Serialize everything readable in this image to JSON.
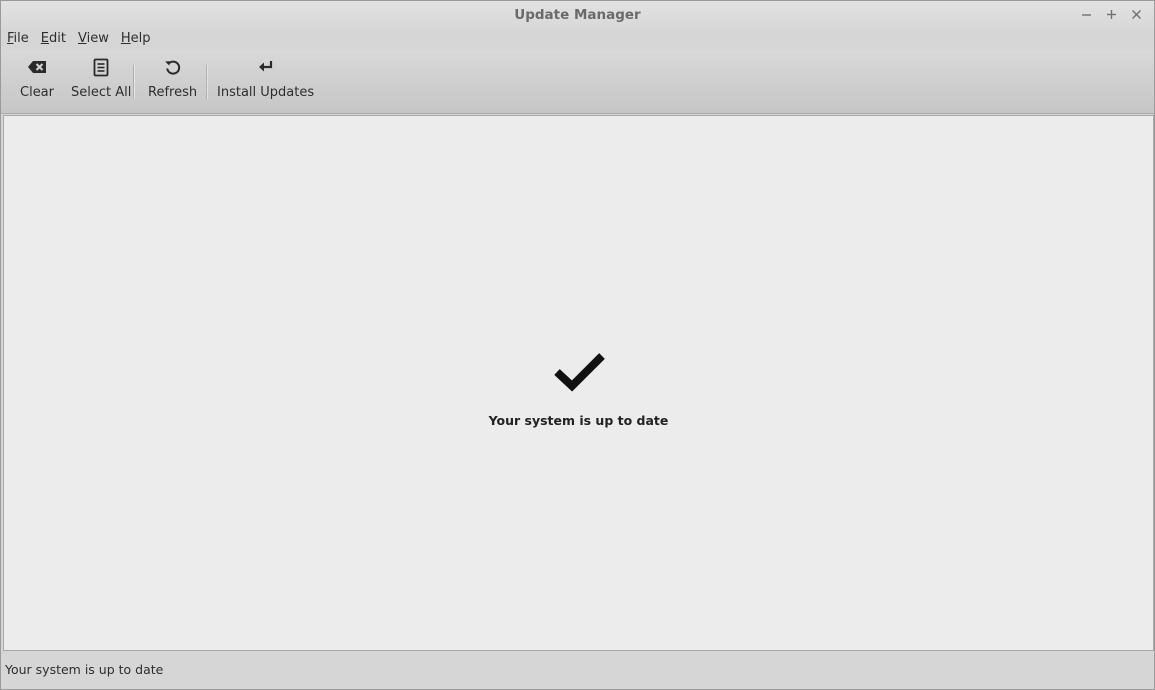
{
  "window": {
    "title": "Update Manager"
  },
  "menubar": {
    "items": [
      {
        "first": "F",
        "rest": "ile"
      },
      {
        "first": "E",
        "rest": "dit"
      },
      {
        "first": "V",
        "rest": "iew"
      },
      {
        "first": "H",
        "rest": "elp"
      }
    ]
  },
  "toolbar": {
    "clear_label": "Clear",
    "select_all_label": "Select All",
    "refresh_label": "Refresh",
    "install_label": "Install Updates"
  },
  "icons": {
    "clear": "backspace-icon",
    "select_all": "document-list-icon",
    "refresh": "refresh-icon",
    "install": "enter-arrow-icon",
    "status": "checkmark-icon"
  },
  "main": {
    "message": "Your system is up to date"
  },
  "statusbar": {
    "text": "Your system is up to date"
  }
}
